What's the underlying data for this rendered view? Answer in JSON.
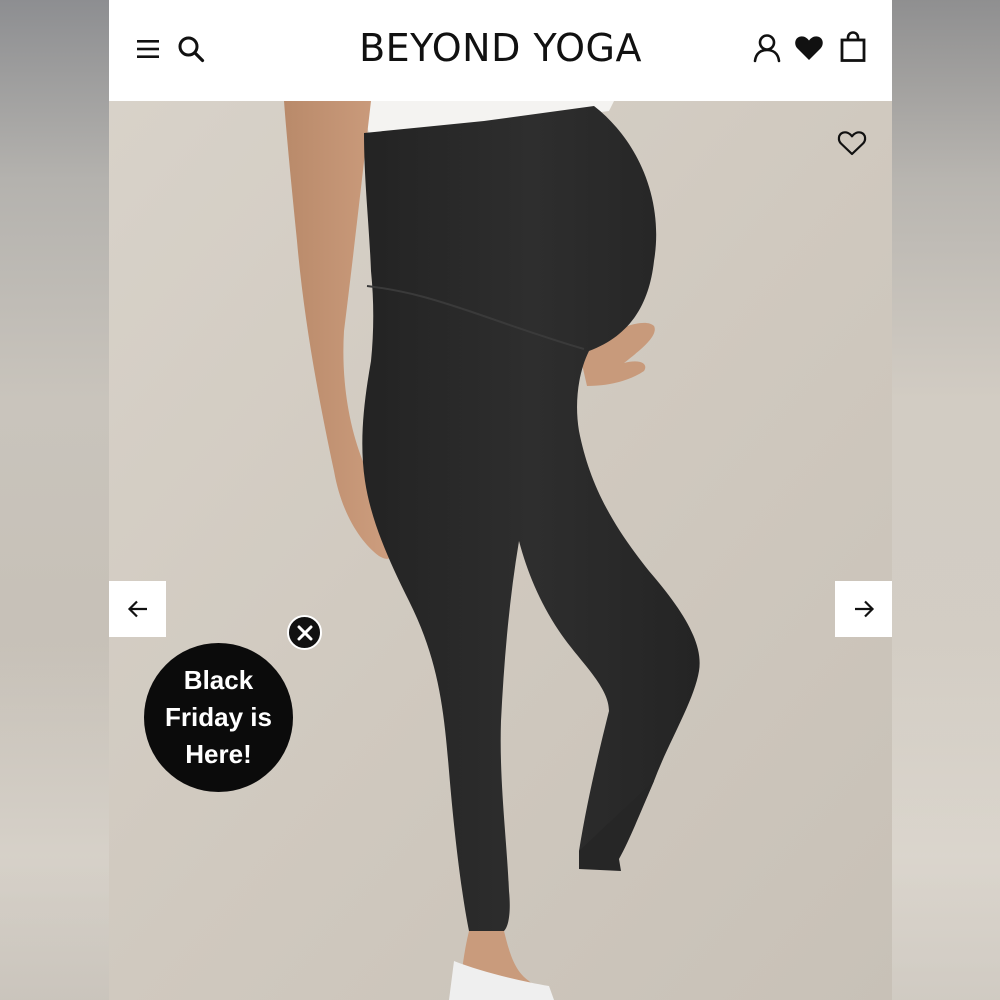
{
  "brand": {
    "name": "BEYOND YOGA"
  },
  "header": {
    "icons": [
      "menu-icon",
      "search-icon",
      "account-icon",
      "heart-icon",
      "bag-icon"
    ]
  },
  "product": {
    "image_subject": "black maternity capri leggings",
    "wishlist_icon": "heart-outline-icon"
  },
  "carousel": {
    "prev_icon": "arrow-left-icon",
    "next_icon": "arrow-right-icon"
  },
  "promo": {
    "text": "Black Friday is Here!",
    "close_icon": "close-icon"
  },
  "colors": {
    "header_bg": "#ffffff",
    "image_bg": "#d3ccc3",
    "leggings": "#2b2b2b",
    "promo_bg": "#0b0b0b",
    "promo_text": "#ffffff"
  }
}
